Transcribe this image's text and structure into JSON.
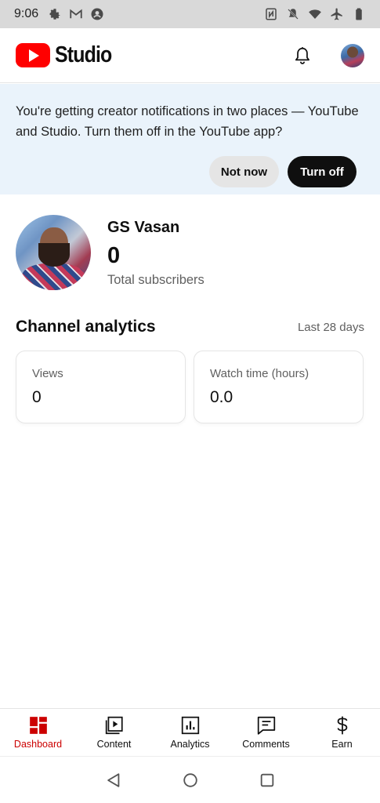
{
  "status_bar": {
    "time": "9:06",
    "left_icons": [
      "settings-icon",
      "gmail-icon",
      "account-icon"
    ],
    "right_icons": [
      "nfc-icon",
      "mute-icon",
      "wifi-icon",
      "airplane-icon",
      "battery-icon"
    ]
  },
  "header": {
    "logo_text": "Studio",
    "brand_color": "#ff0000",
    "actions": [
      "notifications-bell-icon",
      "account-avatar"
    ]
  },
  "banner": {
    "message": "You're getting creator notifications in two places — YouTube and Studio. Turn them off in the YouTube app?",
    "secondary_button": "Not now",
    "primary_button": "Turn off",
    "background_color": "#eaf3fb"
  },
  "channel": {
    "name": "GS Vasan",
    "subscriber_count": "0",
    "subscriber_label": "Total subscribers"
  },
  "analytics": {
    "title": "Channel analytics",
    "range": "Last 28 days",
    "cards": [
      {
        "label": "Views",
        "value": "0"
      },
      {
        "label": "Watch time (hours)",
        "value": "0.0"
      }
    ]
  },
  "bottom_nav": {
    "active_color": "#cc0000",
    "items": [
      {
        "label": "Dashboard",
        "icon": "dashboard-icon",
        "active": true
      },
      {
        "label": "Content",
        "icon": "content-icon",
        "active": false
      },
      {
        "label": "Analytics",
        "icon": "analytics-icon",
        "active": false
      },
      {
        "label": "Comments",
        "icon": "comments-icon",
        "active": false
      },
      {
        "label": "Earn",
        "icon": "earn-icon",
        "active": false
      }
    ]
  },
  "system_nav": [
    "back-icon",
    "home-icon",
    "recents-icon"
  ]
}
